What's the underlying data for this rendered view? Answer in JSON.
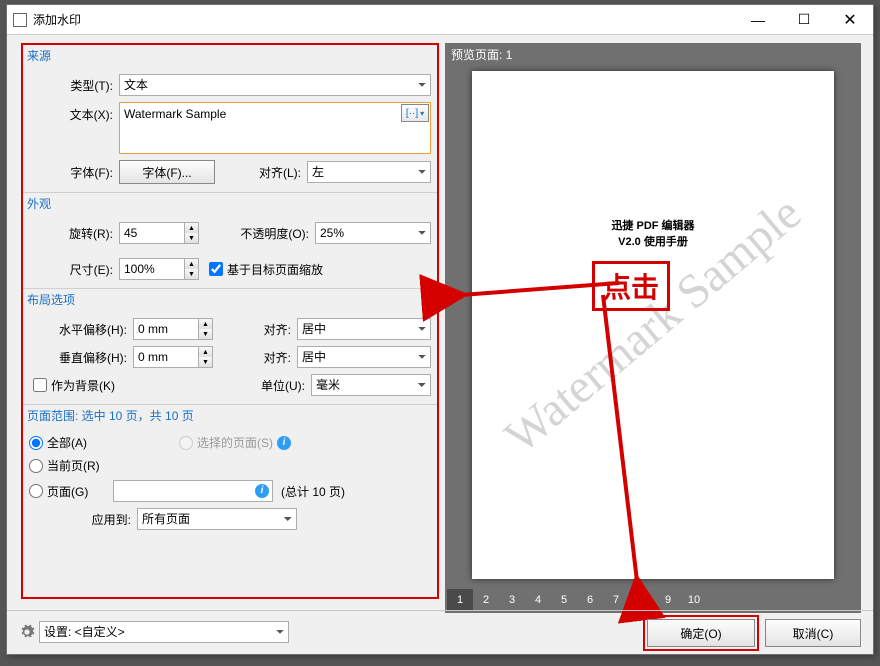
{
  "window": {
    "title": "添加水印"
  },
  "source": {
    "group": "来源",
    "type_label": "类型(T):",
    "type_value": "文本",
    "text_label": "文本(X):",
    "text_value": "Watermark Sample",
    "macro_label": "[··]",
    "font_label": "字体(F):",
    "font_button": "字体(F)...",
    "align_label": "对齐(L):",
    "align_value": "左"
  },
  "appearance": {
    "group": "外观",
    "rotate_label": "旋转(R):",
    "rotate_value": "45",
    "opacity_label": "不透明度(O):",
    "opacity_value": "25%",
    "scale_label": "尺寸(E):",
    "scale_value": "100%",
    "scale_rel_checked": true,
    "scale_rel_label": "基于目标页面缩放"
  },
  "layout": {
    "group": "布局选项",
    "hoffset_label": "水平偏移(H):",
    "hoffset_value": "0 mm",
    "voffset_label": "垂直偏移(H):",
    "voffset_value": "0 mm",
    "halign_label": "对齐:",
    "halign_value": "居中",
    "valign_label": "对齐:",
    "valign_value": "居中",
    "as_bg_label": "作为背景(K)",
    "unit_label": "单位(U):",
    "unit_value": "毫米"
  },
  "range": {
    "group": "页面范围: 选中 10 页，共 10 页",
    "all_label": "全部(A)",
    "current_label": "当前页(R)",
    "pages_label": "页面(G)",
    "selected_label": "选择的页面(S)",
    "total_label": "(总计 10 页)",
    "apply_label": "应用到:",
    "apply_value": "所有页面"
  },
  "preview": {
    "title": "预览页面: 1",
    "doc_line1": "迅捷 PDF 编辑器",
    "doc_line2": "V2.0 使用手册",
    "watermark": "Watermark Sample",
    "callout": "点击",
    "pages": [
      "1",
      "2",
      "3",
      "4",
      "5",
      "6",
      "7",
      "8",
      "9",
      "10"
    ],
    "active_page": "1"
  },
  "bottom": {
    "settings_label": "设置: <自定义>",
    "ok": "确定(O)",
    "cancel": "取消(C)"
  }
}
